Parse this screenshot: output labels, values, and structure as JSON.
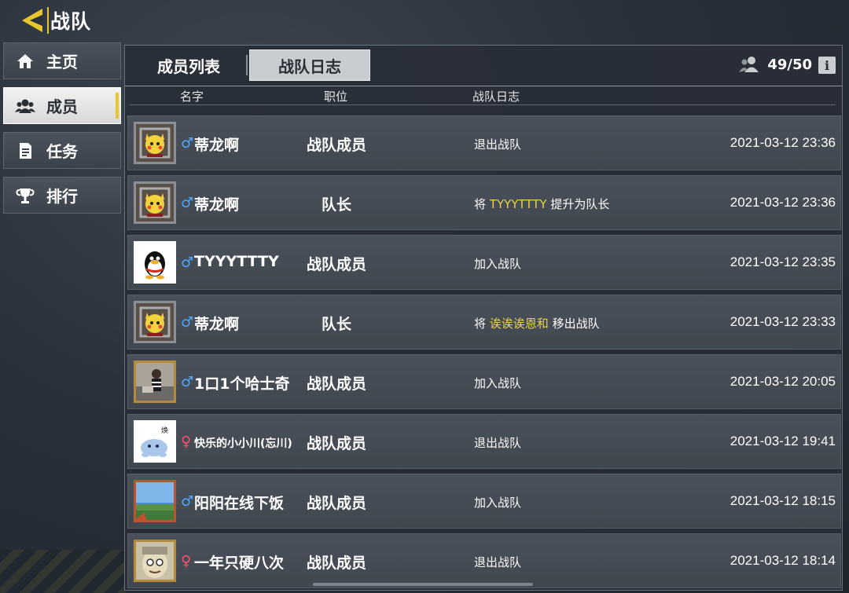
{
  "header": {
    "title": "战队"
  },
  "sidebar": {
    "items": [
      {
        "label": "主页",
        "icon": "home-icon"
      },
      {
        "label": "成员",
        "icon": "members-icon"
      },
      {
        "label": "任务",
        "icon": "task-icon"
      },
      {
        "label": "排行",
        "icon": "trophy-icon"
      }
    ],
    "active_index": 1
  },
  "tabs": {
    "members_label": "成员列表",
    "log_label": "战队日志",
    "active": "战队日志"
  },
  "count": "49/50",
  "info_label": "i",
  "columns": {
    "name": "名字",
    "position": "职位",
    "log": "战队日志"
  },
  "rows": [
    {
      "gender": "♂",
      "name": "蒂龙啊",
      "position": "战队成员",
      "log": {
        "pre": "退出战队",
        "hl": "",
        "post": ""
      },
      "time": "2021-03-12 23:36"
    },
    {
      "gender": "♂",
      "name": "蒂龙啊",
      "position": "队长",
      "log": {
        "pre": "将 ",
        "hl": "TYYYTTTY",
        "post": " 提升为队长"
      },
      "time": "2021-03-12 23:36"
    },
    {
      "gender": "♂",
      "name": "TYYYTTTY",
      "position": "战队成员",
      "log": {
        "pre": "加入战队",
        "hl": "",
        "post": ""
      },
      "time": "2021-03-12 23:35"
    },
    {
      "gender": "♂",
      "name": "蒂龙啊",
      "position": "队长",
      "log": {
        "pre": "将 ",
        "hl": "诶诶诶恩和",
        "post": " 移出战队"
      },
      "time": "2021-03-12 23:33"
    },
    {
      "gender": "♂",
      "name": "1口1个哈士奇",
      "position": "战队成员",
      "log": {
        "pre": "加入战队",
        "hl": "",
        "post": ""
      },
      "time": "2021-03-12 20:05"
    },
    {
      "gender": "♀",
      "name": "快乐的小小川(忘川)",
      "position": "战队成员",
      "log": {
        "pre": "退出战队",
        "hl": "",
        "post": ""
      },
      "time": "2021-03-12 19:41"
    },
    {
      "gender": "♂",
      "name": "阳阳在线下饭",
      "position": "战队成员",
      "log": {
        "pre": "加入战队",
        "hl": "",
        "post": ""
      },
      "time": "2021-03-12 18:15"
    },
    {
      "gender": "♀",
      "name": "一年只硬八次",
      "position": "战队成员",
      "log": {
        "pre": "退出战队",
        "hl": "",
        "post": ""
      },
      "time": "2021-03-12 18:14"
    }
  ],
  "colors": {
    "accent": "#e8c630",
    "highlight": "#e8d24a",
    "male": "#4ea8ff",
    "female": "#ff4f6b"
  }
}
